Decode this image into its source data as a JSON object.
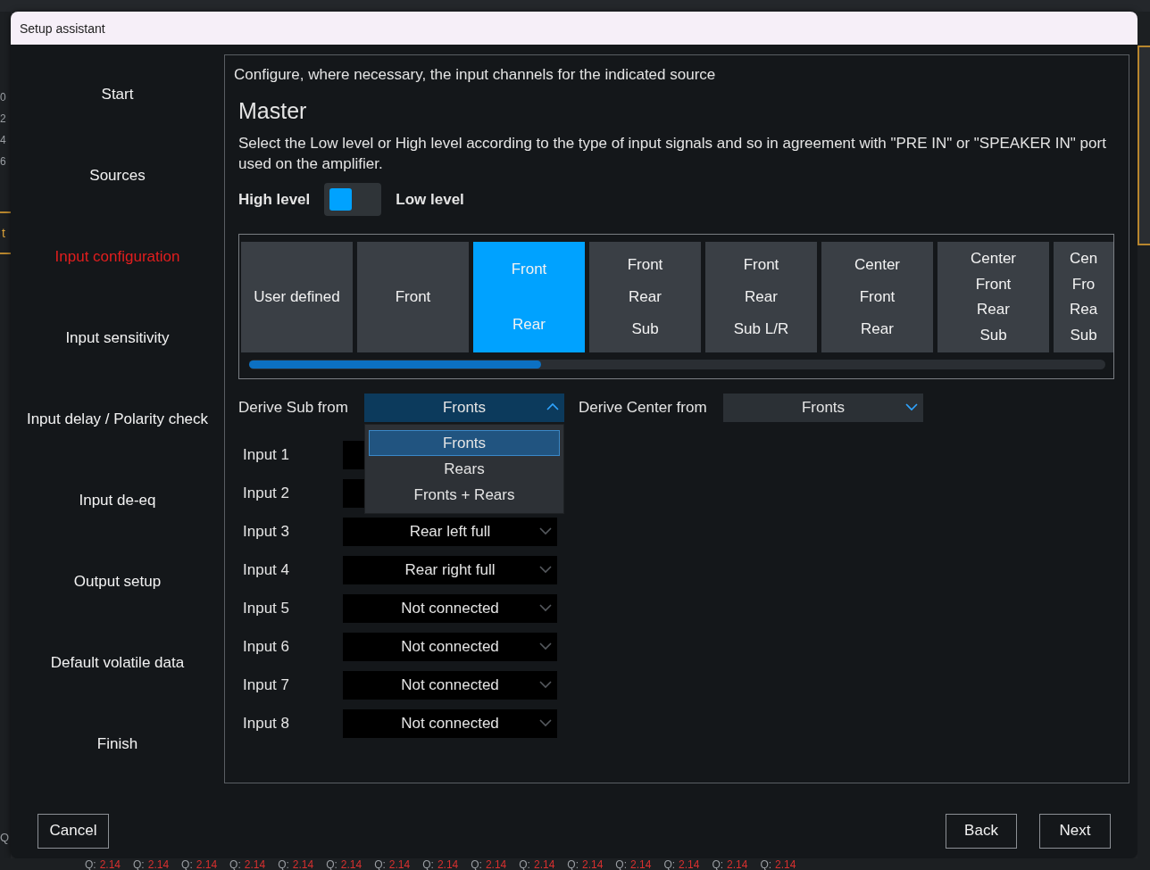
{
  "background": {
    "scale": [
      "0",
      "2",
      "4",
      "6"
    ],
    "tab_fragment": "t",
    "corner_fragment": "Q",
    "q_values": [
      {
        "label": "Q:",
        "value": "2.14"
      },
      {
        "label": "Q:",
        "value": "2.14"
      },
      {
        "label": "Q:",
        "value": "2.14"
      },
      {
        "label": "Q:",
        "value": "2.14"
      },
      {
        "label": "Q:",
        "value": "2.14"
      },
      {
        "label": "Q:",
        "value": "2.14"
      },
      {
        "label": "Q:",
        "value": "2.14"
      },
      {
        "label": "Q:",
        "value": "2.14"
      },
      {
        "label": "Q:",
        "value": "2.14"
      },
      {
        "label": "Q:",
        "value": "2.14"
      },
      {
        "label": "Q:",
        "value": "2.14"
      },
      {
        "label": "Q:",
        "value": "2.14"
      },
      {
        "label": "Q:",
        "value": "2.14"
      },
      {
        "label": "Q:",
        "value": "2.14"
      },
      {
        "label": "Q:",
        "value": "2.14"
      }
    ]
  },
  "window": {
    "title": "Setup assistant"
  },
  "sidebar": {
    "items": [
      {
        "label": "Start",
        "selected": false
      },
      {
        "label": "Sources",
        "selected": false
      },
      {
        "label": "Input configuration",
        "selected": true
      },
      {
        "label": "Input sensitivity",
        "selected": false
      },
      {
        "label": "Input delay / Polarity check",
        "selected": false
      },
      {
        "label": "Input de-eq",
        "selected": false
      },
      {
        "label": "Output setup",
        "selected": false
      },
      {
        "label": "Default volatile data",
        "selected": false
      },
      {
        "label": "Finish",
        "selected": false
      }
    ]
  },
  "main": {
    "instruction": "Configure, where necessary, the input channels for the indicated source",
    "heading": "Master",
    "description": "Select the Low level or High level according to the type of input signals and so in agreement with \"PRE IN\" or \"SPEAKER IN\" port used on the amplifier.",
    "level_switch": {
      "left_label": "High level",
      "right_label": "Low level",
      "on": false
    },
    "presets": [
      {
        "lines": [
          "User defined"
        ],
        "selected": false
      },
      {
        "lines": [
          "Front"
        ],
        "selected": false
      },
      {
        "lines": [
          "Front",
          "Rear"
        ],
        "selected": true
      },
      {
        "lines": [
          "Front",
          "Rear",
          "Sub"
        ],
        "selected": false
      },
      {
        "lines": [
          "Front",
          "Rear",
          "Sub L/R"
        ],
        "selected": false
      },
      {
        "lines": [
          "Center",
          "Front",
          "Rear"
        ],
        "selected": false
      },
      {
        "lines": [
          "Center",
          "Front",
          "Rear",
          "Sub"
        ],
        "selected": false
      },
      {
        "lines": [
          "Cen",
          "Fro",
          "Rea",
          "Sub"
        ],
        "selected": false
      }
    ],
    "derive_sub": {
      "label": "Derive Sub from",
      "value": "Fronts",
      "expanded": true,
      "options": [
        {
          "label": "Fronts",
          "selected": true
        },
        {
          "label": "Rears",
          "selected": false
        },
        {
          "label": "Fronts + Rears",
          "selected": false
        }
      ]
    },
    "derive_center": {
      "label": "Derive Center from",
      "value": "Fronts",
      "expanded": false
    },
    "inputs": [
      {
        "label": "Input 1"
      },
      {
        "label": "Input 2"
      },
      {
        "label": "Input 3",
        "value": "Rear left full"
      },
      {
        "label": "Input 4",
        "value": "Rear right full"
      },
      {
        "label": "Input 5",
        "value": "Not connected"
      },
      {
        "label": "Input 6",
        "value": "Not connected"
      },
      {
        "label": "Input 7",
        "value": "Not connected"
      },
      {
        "label": "Input 8",
        "value": "Not connected"
      }
    ]
  },
  "footer": {
    "buttons": [
      {
        "label": "Cancel",
        "kind": "left"
      },
      {
        "label": "Back",
        "kind": "right"
      },
      {
        "label": "Next",
        "kind": "right"
      }
    ]
  }
}
